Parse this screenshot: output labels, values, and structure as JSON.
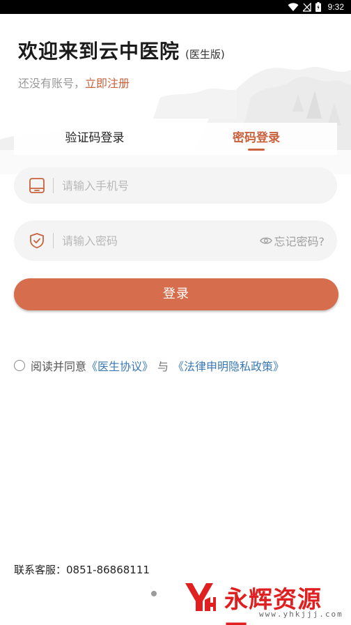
{
  "status_bar": {
    "time": "9:32"
  },
  "header": {
    "title": "欢迎来到云中医院",
    "subtitle": "(医生版)",
    "register_prompt": "还没有账号，",
    "register_link": "立即注册"
  },
  "tabs": [
    {
      "label": "验证码登录",
      "active": false
    },
    {
      "label": "密码登录",
      "active": true
    }
  ],
  "form": {
    "phone_placeholder": "请输入手机号",
    "password_placeholder": "请输入密码",
    "forgot_label": "忘记密码?",
    "login_label": "登录"
  },
  "agreement": {
    "checked": false,
    "prefix": "阅读并同意",
    "doctor_agreement": "《医生协议》",
    "and": "与",
    "legal_policy": "《法律申明隐私政策》"
  },
  "contact": {
    "label": "联系客服：0851-86868111"
  },
  "watermark": {
    "name": "永辉资源网",
    "url": "www.yhkjjj.com"
  },
  "icons": {
    "status": [
      "wifi-icon",
      "signal-icon",
      "battery-icon"
    ],
    "phone_field": "tablet-icon",
    "password_field": "shield-icon",
    "forgot": "eye-icon"
  },
  "colors": {
    "accent": "#c8613c",
    "button": "#d66d4c",
    "link": "#3a78b5",
    "field_bg": "#f4f4f4"
  }
}
